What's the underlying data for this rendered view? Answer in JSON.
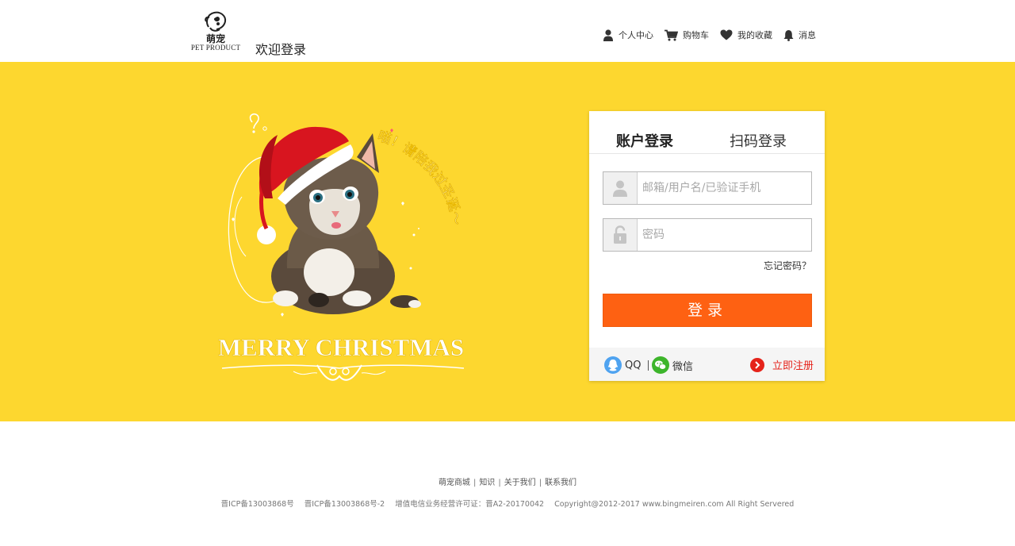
{
  "brand": {
    "logo_cn": "萌宠",
    "logo_en": "PET PRODUCT",
    "welcome": "欢迎登录"
  },
  "topnav": [
    {
      "label": "个人中心",
      "icon": "user-icon"
    },
    {
      "label": "购物车",
      "icon": "cart-icon"
    },
    {
      "label": "我的收藏",
      "icon": "heart-icon"
    },
    {
      "label": "消息",
      "icon": "bell-icon"
    }
  ],
  "hero": {
    "background": "#fdd72f",
    "curved_text": "喵！请陪我过圣诞～",
    "banner_text": "MERRY CHRISTMAS"
  },
  "login": {
    "tab_account": "账户登录",
    "tab_qrcode": "扫码登录",
    "username_placeholder": "邮箱/用户名/已验证手机",
    "password_placeholder": "密码",
    "forgot": "忘记密码？",
    "submit": "登录",
    "submit_color": "#fe6112",
    "qq": "QQ",
    "wechat": "微信",
    "register": "立即注册",
    "register_color": "#e5231a"
  },
  "footer": {
    "links": [
      "萌宠商城",
      "知识",
      "关于我们",
      "联系我们"
    ],
    "icp1": "晋ICP备13003868号",
    "icp2": "晋ICP备13003868号-2",
    "telecom": "增值电信业务经营许可证：晋A2-20170042",
    "copyright": "Copyright@2012-2017 www.bingmeiren.com  All Right Servered"
  }
}
